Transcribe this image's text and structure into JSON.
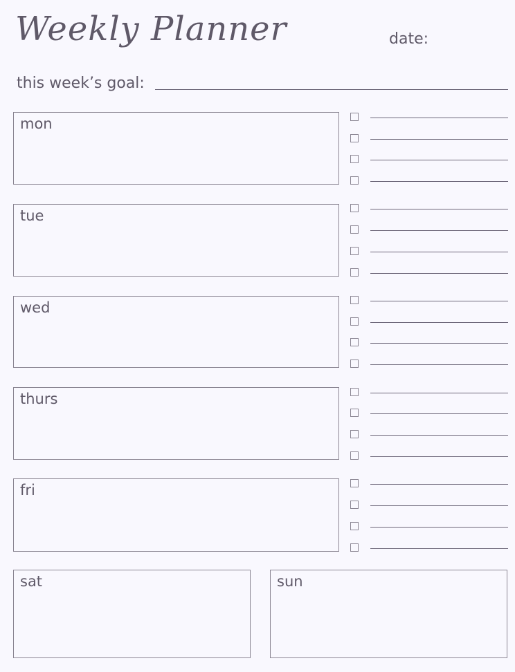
{
  "header": {
    "title": "Weekly Planner",
    "date_label": "date:",
    "goal_label": "this week’s goal:"
  },
  "days": {
    "mon": "mon",
    "tue": "tue",
    "wed": "wed",
    "thurs": "thurs",
    "fri": "fri",
    "sat": "sat",
    "sun": "sun"
  },
  "todo": {
    "items_per_day": 4
  }
}
